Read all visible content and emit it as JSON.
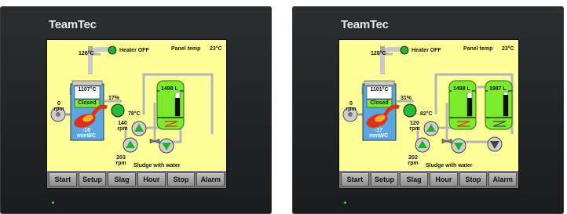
{
  "brand": "TeamTec",
  "nav": [
    "Start",
    "Setup",
    "Slag",
    "Hour",
    "Stop",
    "Alarm"
  ],
  "colors": {
    "screen_bg": "#ffff99",
    "tank_green": "#7cec2a",
    "boiler_blue": "#5aa6e0",
    "flame_red": "#e0301a",
    "pipe_grey": "#b5b5b5"
  },
  "panels": [
    {
      "flue_temp": "128°C",
      "heater": "Heater OFF",
      "panel_temp_label": "Panel temp",
      "panel_temp": "23°C",
      "fan_speed": "0",
      "fan_unit": "rpm",
      "furnace_temp": "1107°C",
      "damper": "Closed",
      "pressure": "-16",
      "pressure_unit": "mmWC",
      "valve_pct": "17%",
      "oil_temp": "78°C",
      "pump_speed": "140",
      "pump_unit": "rpm",
      "feed_speed": "203",
      "feed_unit": "rpm",
      "tank1_level": "1498 L",
      "sludge_label": "Sludge with water"
    },
    {
      "flue_temp": "128°C",
      "heater": "Heater OFF",
      "panel_temp_label": "Panel temp",
      "panel_temp": "23°C",
      "fan_speed": "0",
      "fan_unit": "rpm",
      "furnace_temp": "1101°C",
      "damper": "Closed",
      "pressure": "-17",
      "pressure_unit": "mmWC",
      "valve_pct": "31%",
      "oil_temp": "82°C",
      "pump_speed": "120",
      "pump_unit": "rpm",
      "feed_speed": "202",
      "feed_unit": "rpm",
      "tank1_level": "1498 L",
      "tank2_level": "1987 L",
      "sludge_label": "Sludge with water"
    }
  ]
}
